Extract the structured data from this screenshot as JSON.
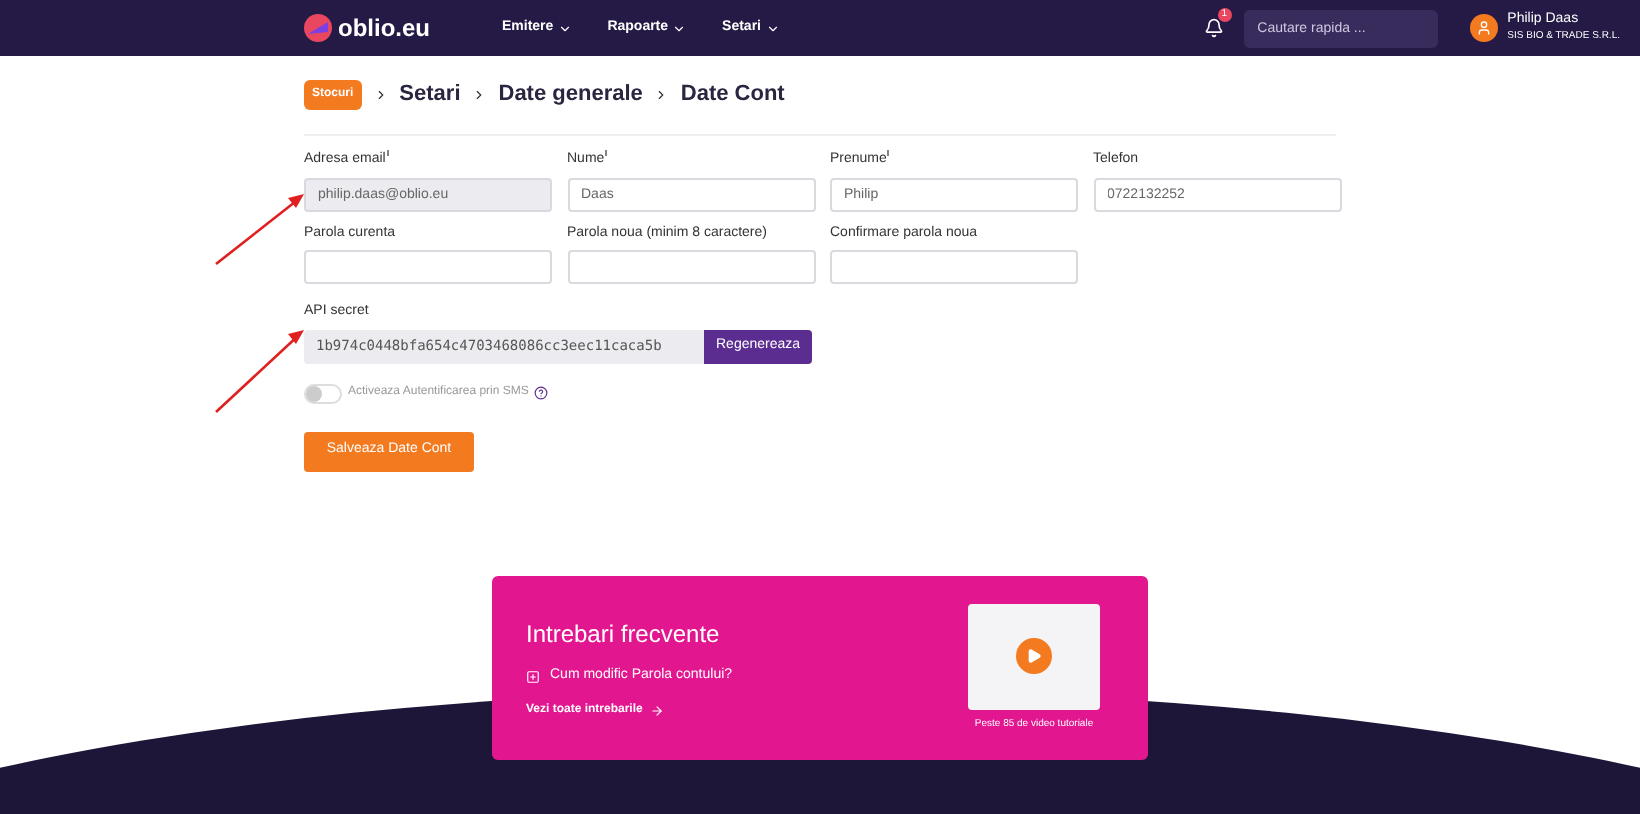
{
  "header": {
    "logo": "oblio.eu",
    "menu": [
      {
        "label": "Emitere"
      },
      {
        "label": "Rapoarte"
      },
      {
        "label": "Setari"
      }
    ],
    "notification_count": "1",
    "search": {
      "placeholder": "Cautare rapida ..."
    },
    "user": {
      "name": "Philip Daas",
      "company": "SIS BIO & TRADE S.R.L."
    }
  },
  "breadcrumb": {
    "badge": "Stocuri",
    "items": [
      "Setari",
      "Date generale",
      "Date Cont"
    ]
  },
  "fields": [
    {
      "label": "Adresa email",
      "required": true,
      "value": "philip.daas@oblio.eu",
      "disabled": true
    },
    {
      "label": "Nume",
      "required": true,
      "value": "Daas",
      "disabled": false
    },
    {
      "label": "Prenume",
      "required": true,
      "value": "Philip",
      "disabled": false
    },
    {
      "label": "Telefon",
      "required": false,
      "value": "0722132252",
      "disabled": false
    },
    {
      "label": "Parola curenta",
      "required": false,
      "disabled": false
    },
    {
      "label": "Parola noua (minim 8 caractere)",
      "required": false,
      "disabled": false
    },
    {
      "label": "Confirmare parola noua",
      "required": false,
      "disabled": false
    }
  ],
  "api_secret": {
    "label": "API secret",
    "value": "1b974c0448bfa654c4703468086cc3eec11caca5b",
    "button": "Regenereaza"
  },
  "sms_toggle": {
    "label": "Activeaza Autentificarea prin SMS",
    "on": false
  },
  "save_button": "Salveaza Date Cont",
  "faq": {
    "title": "Intrebari frecvente",
    "question": "Cum modific Parola contului?",
    "link": "Vezi toate intrebarile",
    "video_caption": "Peste 85 de video tutoriale"
  }
}
